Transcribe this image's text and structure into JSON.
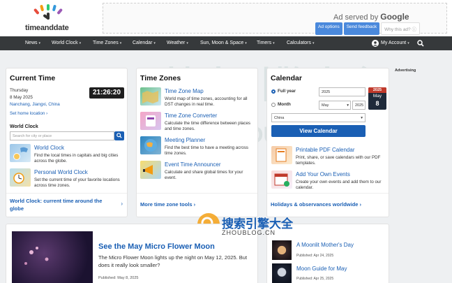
{
  "brand": {
    "name": "timeanddate"
  },
  "ad": {
    "served_by": "Ad served by",
    "google": "Google",
    "options": "Ad options",
    "feedback": "Send feedback",
    "why": "Why this ad? ⓘ"
  },
  "nav": {
    "items": [
      "News",
      "World Clock",
      "Time Zones",
      "Calendar",
      "Weather",
      "Sun, Moon & Space",
      "Timers",
      "Calculators"
    ],
    "account": "My Account"
  },
  "advertising_label": "Advertising",
  "current_time": {
    "title": "Current Time",
    "day": "Thursday",
    "date": "8 May 2025",
    "location": "Nanchang, Jiangxi, China",
    "clock": "21:26:20",
    "home_link": "Set home location",
    "world_clock_label": "World Clock",
    "search_placeholder": "Search for city or place",
    "features": [
      {
        "title": "World Clock",
        "desc": "Find the local times in capitals and big cities across the globe."
      },
      {
        "title": "Personal World Clock",
        "desc": "Set the current time of your favorite locations across time zones."
      }
    ],
    "footer": "World Clock: current time around the globe"
  },
  "time_zones": {
    "title": "Time Zones",
    "features": [
      {
        "title": "Time Zone Map",
        "desc": "World map of time zones, accounting for all DST changes in real time."
      },
      {
        "title": "Time Zone Converter",
        "desc": "Calculate the time difference between places and time zones."
      },
      {
        "title": "Meeting Planner",
        "desc": "Find the best time to have a meeting across time zones."
      },
      {
        "title": "Event Time Announcer",
        "desc": "Calculate and share global times for your event."
      }
    ],
    "footer": "More time zone tools"
  },
  "calendar": {
    "title": "Calendar",
    "full_year_label": "Full year",
    "year_value": "2025",
    "month_label": "Month",
    "month_value": "May",
    "month_year_value": "2025",
    "country_value": "China",
    "badge_year": "2025",
    "badge_month": "May",
    "badge_day": "8",
    "button": "View Calendar",
    "features": [
      {
        "title": "Printable PDF Calendar",
        "desc": "Print, share, or save calendars with our PDF templates."
      },
      {
        "title": "Add Your Own Events",
        "desc": "Create your own events and add them to our calendar."
      }
    ],
    "footer": "Holidays & observances worldwide"
  },
  "article": {
    "title": "See the May Micro Flower Moon",
    "desc": "The Micro Flower Moon lights up the night on May 12, 2025. But does it really look smaller?",
    "published": "Published: May 8, 2025"
  },
  "side_articles": [
    {
      "title": "A Moonlit Mother's Day",
      "published": "Published: Apr 24, 2025"
    },
    {
      "title": "Moon Guide for May",
      "published": "Published: Apr 25, 2025"
    }
  ],
  "watermark": {
    "cn": "搜索引擎大全",
    "url": "ZHOUBLOG.CN"
  },
  "colors": {
    "nav_bg": "#36393b",
    "link": "#1a5fb4",
    "button": "#1a5fb4",
    "clock_bg": "#1e1e1e",
    "badge_top": "#c0392b"
  }
}
